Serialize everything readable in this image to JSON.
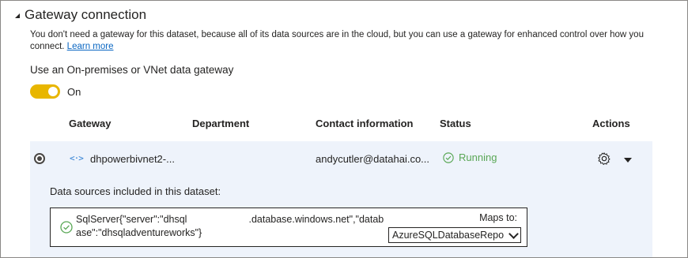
{
  "section": {
    "title": "Gateway connection"
  },
  "description": {
    "text": "You don't need a gateway for this dataset, because all of its data sources are in the cloud, but you can use a gateway for enhanced control over how you connect. ",
    "link": "Learn more"
  },
  "toggle": {
    "label": "Use an On-premises or VNet data gateway",
    "state": "On",
    "on": true,
    "color": "#e8b600"
  },
  "table": {
    "headers": {
      "gateway": "Gateway",
      "department": "Department",
      "contact": "Contact information",
      "status": "Status",
      "actions": "Actions"
    },
    "rows": [
      {
        "selected": true,
        "icon": "gateway-icon",
        "gateway": "dhpowerbivnet2-...",
        "department": "",
        "contact": "andycutler@datahai.co...",
        "status": "Running",
        "status_color": "#59a755"
      }
    ]
  },
  "datasources": {
    "title": "Data sources included in this dataset:",
    "items": [
      {
        "text_start": "SqlServer{\"server\":\"dhsql",
        "text_end": ".database.windows.net\",\"database\":\"dhsqladventureworks\"}",
        "maps_label": "Maps to:",
        "mapped_value": "AzureSQLDatabaseRepo"
      }
    ]
  },
  "colors": {
    "accent": "#e8b600",
    "link": "#0a66c2",
    "success": "#59a755",
    "row_bg": "#eef3fb"
  }
}
